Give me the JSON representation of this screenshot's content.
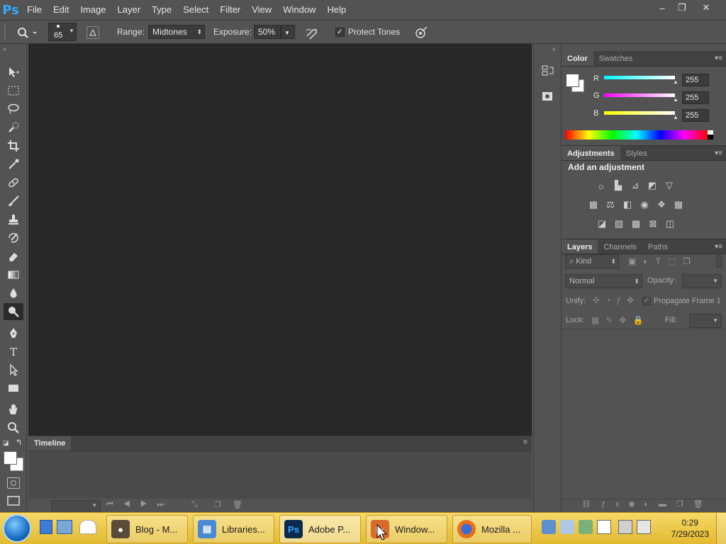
{
  "app": {
    "logo": "Ps",
    "menu": [
      "File",
      "Edit",
      "Image",
      "Layer",
      "Type",
      "Select",
      "Filter",
      "View",
      "Window",
      "Help"
    ],
    "window_controls": [
      "–",
      "❐",
      "✕"
    ]
  },
  "options_bar": {
    "brush_size": "65",
    "range_label": "Range:",
    "range_value": "Midtones",
    "exposure_label": "Exposure:",
    "exposure_value": "50%",
    "protect_tones_label": "Protect Tones",
    "protect_tones_checked": true
  },
  "timeline": {
    "title": "Timeline"
  },
  "color_panel": {
    "tabs": [
      "Color",
      "Swatches"
    ],
    "channels": [
      {
        "label": "R",
        "value": "255"
      },
      {
        "label": "G",
        "value": "255"
      },
      {
        "label": "B",
        "value": "255"
      }
    ]
  },
  "adjustments_panel": {
    "tabs": [
      "Adjustments",
      "Styles"
    ],
    "heading": "Add an adjustment"
  },
  "layers_panel": {
    "tabs": [
      "Layers",
      "Channels",
      "Paths"
    ],
    "kind_filter": "Kind",
    "blend_mode": "Normal",
    "opacity_label": "Opacity:",
    "unify_label": "Unify:",
    "propagate_label": "Propagate Frame 1",
    "lock_label": "Lock:",
    "fill_label": "Fill:"
  },
  "taskbar": {
    "tasks": [
      {
        "label": "Blog - M..."
      },
      {
        "label": "Libraries..."
      },
      {
        "label": "Adobe P..."
      },
      {
        "label": "Window..."
      },
      {
        "label": "Mozilla ..."
      }
    ],
    "clock_time": "0:29",
    "clock_date": "7/29/2023"
  },
  "colors": {
    "ui_bg": "#535353",
    "canvas_bg": "#282828",
    "ps_blue": "#31a8ff",
    "taskbar": "#f0c94a"
  }
}
